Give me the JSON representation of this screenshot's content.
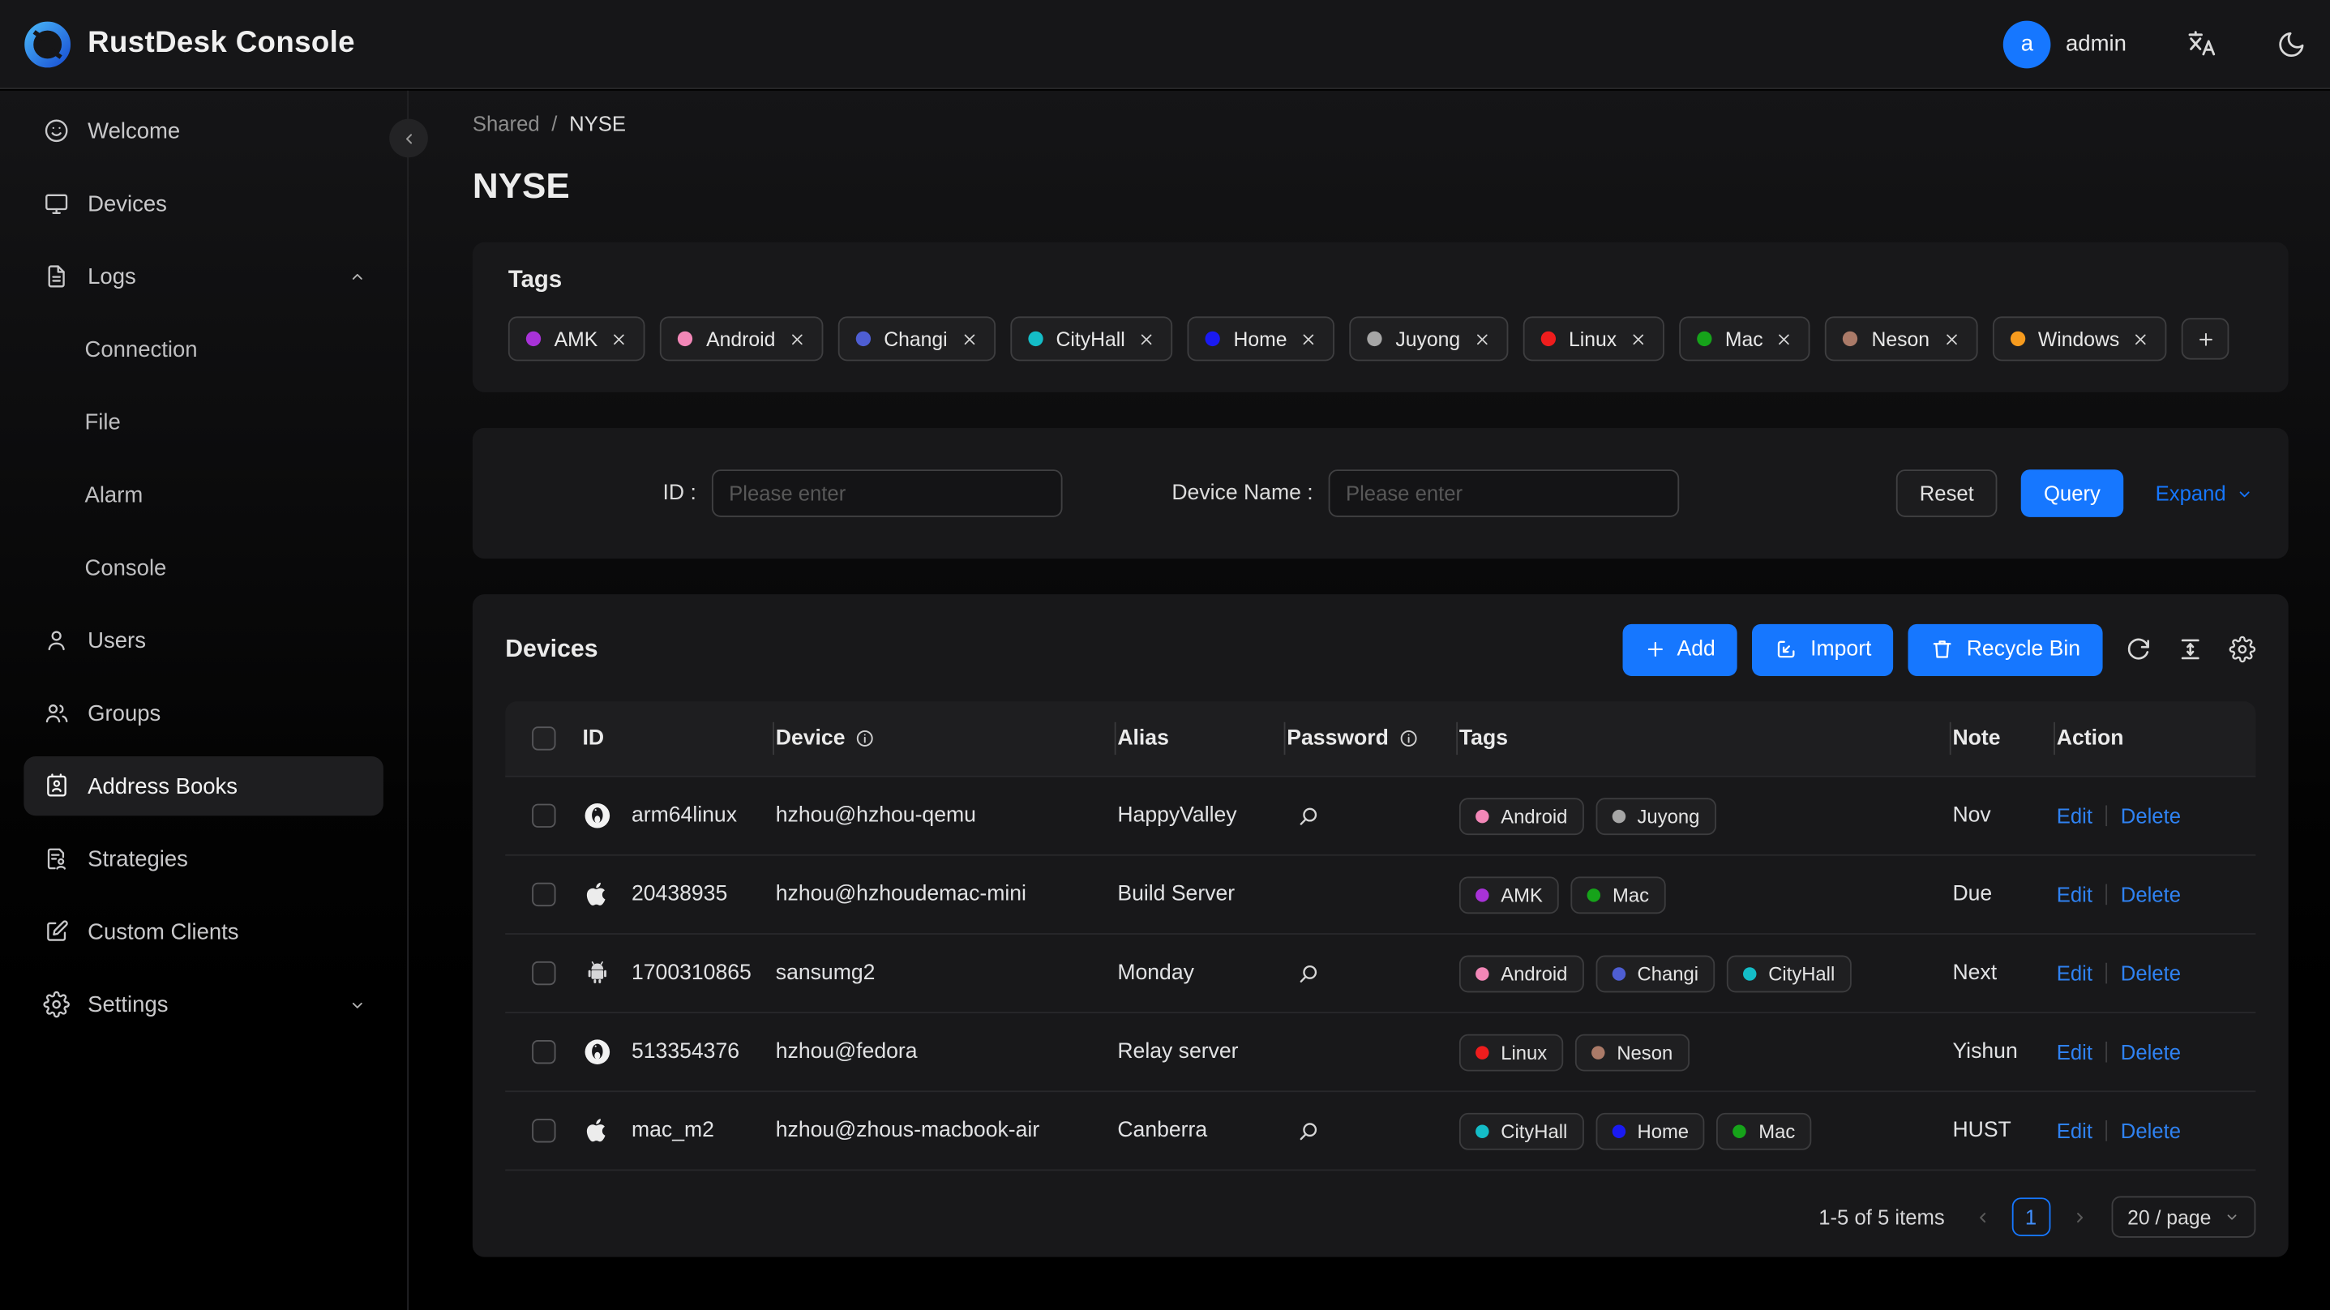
{
  "header": {
    "app_title": "RustDesk Console",
    "user_name": "admin",
    "avatar_letter": "a"
  },
  "sidebar": {
    "items": [
      {
        "label": "Welcome",
        "icon": "smile-icon"
      },
      {
        "label": "Devices",
        "icon": "monitor-icon"
      },
      {
        "label": "Logs",
        "icon": "file-text-icon",
        "expanded": true,
        "children": [
          "Connection",
          "File",
          "Alarm",
          "Console"
        ]
      },
      {
        "label": "Users",
        "icon": "user-icon"
      },
      {
        "label": "Groups",
        "icon": "group-icon"
      },
      {
        "label": "Address Books",
        "icon": "address-book-icon",
        "selected": true
      },
      {
        "label": "Strategies",
        "icon": "strategy-icon"
      },
      {
        "label": "Custom Clients",
        "icon": "edit-square-icon"
      },
      {
        "label": "Settings",
        "icon": "gear-icon",
        "collapsed": true
      }
    ]
  },
  "breadcrumb": {
    "parent": "Shared",
    "separator": "/",
    "current": "NYSE"
  },
  "page_title": "NYSE",
  "tag_colors": {
    "AMK": "#a832d8",
    "Android": "#f287b7",
    "Changi": "#4e5ed3",
    "CityHall": "#14bdc8",
    "Home": "#1a1af2",
    "Juyong": "#a6a6a6",
    "Linux": "#ef1d1d",
    "Mac": "#16a31a",
    "Neson": "#aa7a68",
    "Windows": "#f79b1e"
  },
  "tags_card": {
    "title": "Tags",
    "tags": [
      "AMK",
      "Android",
      "Changi",
      "CityHall",
      "Home",
      "Juyong",
      "Linux",
      "Mac",
      "Neson",
      "Windows"
    ],
    "add_button": "+"
  },
  "filter_card": {
    "id_label": "ID :",
    "id_placeholder": "Please enter",
    "device_label": "Device Name :",
    "device_placeholder": "Please enter",
    "reset_button": "Reset",
    "query_button": "Query",
    "expand_link": "Expand"
  },
  "devices_card": {
    "title": "Devices",
    "add_button": "Add",
    "import_button": "Import",
    "recycle_button": "Recycle Bin",
    "columns": {
      "id": "ID",
      "device": "Device",
      "alias": "Alias",
      "password": "Password",
      "tags": "Tags",
      "note": "Note",
      "action": "Action"
    },
    "edit_label": "Edit",
    "delete_label": "Delete",
    "rows": [
      {
        "os": "linux",
        "id": "arm64linux",
        "device": "hzhou@hzhou-qemu",
        "alias": "HappyValley",
        "has_password": true,
        "tags": [
          "Android",
          "Juyong"
        ],
        "note": "Nov"
      },
      {
        "os": "apple",
        "id": "20438935",
        "device": "hzhou@hzhoudemac-mini",
        "alias": "Build Server",
        "has_password": false,
        "tags": [
          "AMK",
          "Mac"
        ],
        "note": "Due"
      },
      {
        "os": "android",
        "id": "1700310865",
        "device": "sansumg2",
        "alias": "Monday",
        "has_password": true,
        "tags": [
          "Android",
          "Changi",
          "CityHall"
        ],
        "note": "Next"
      },
      {
        "os": "linux",
        "id": "513354376",
        "device": "hzhou@fedora",
        "alias": "Relay server",
        "has_password": false,
        "tags": [
          "Linux",
          "Neson"
        ],
        "note": "Yishun"
      },
      {
        "os": "apple",
        "id": "mac_m2",
        "device": "hzhou@zhous-macbook-air",
        "alias": "Canberra",
        "has_password": true,
        "tags": [
          "CityHall",
          "Home",
          "Mac"
        ],
        "note": "HUST"
      }
    ]
  },
  "pagination": {
    "total_text": "1-5 of 5 items",
    "current_page": "1",
    "page_size": "20 / page"
  },
  "colors": {
    "primary": "#1677ff"
  }
}
